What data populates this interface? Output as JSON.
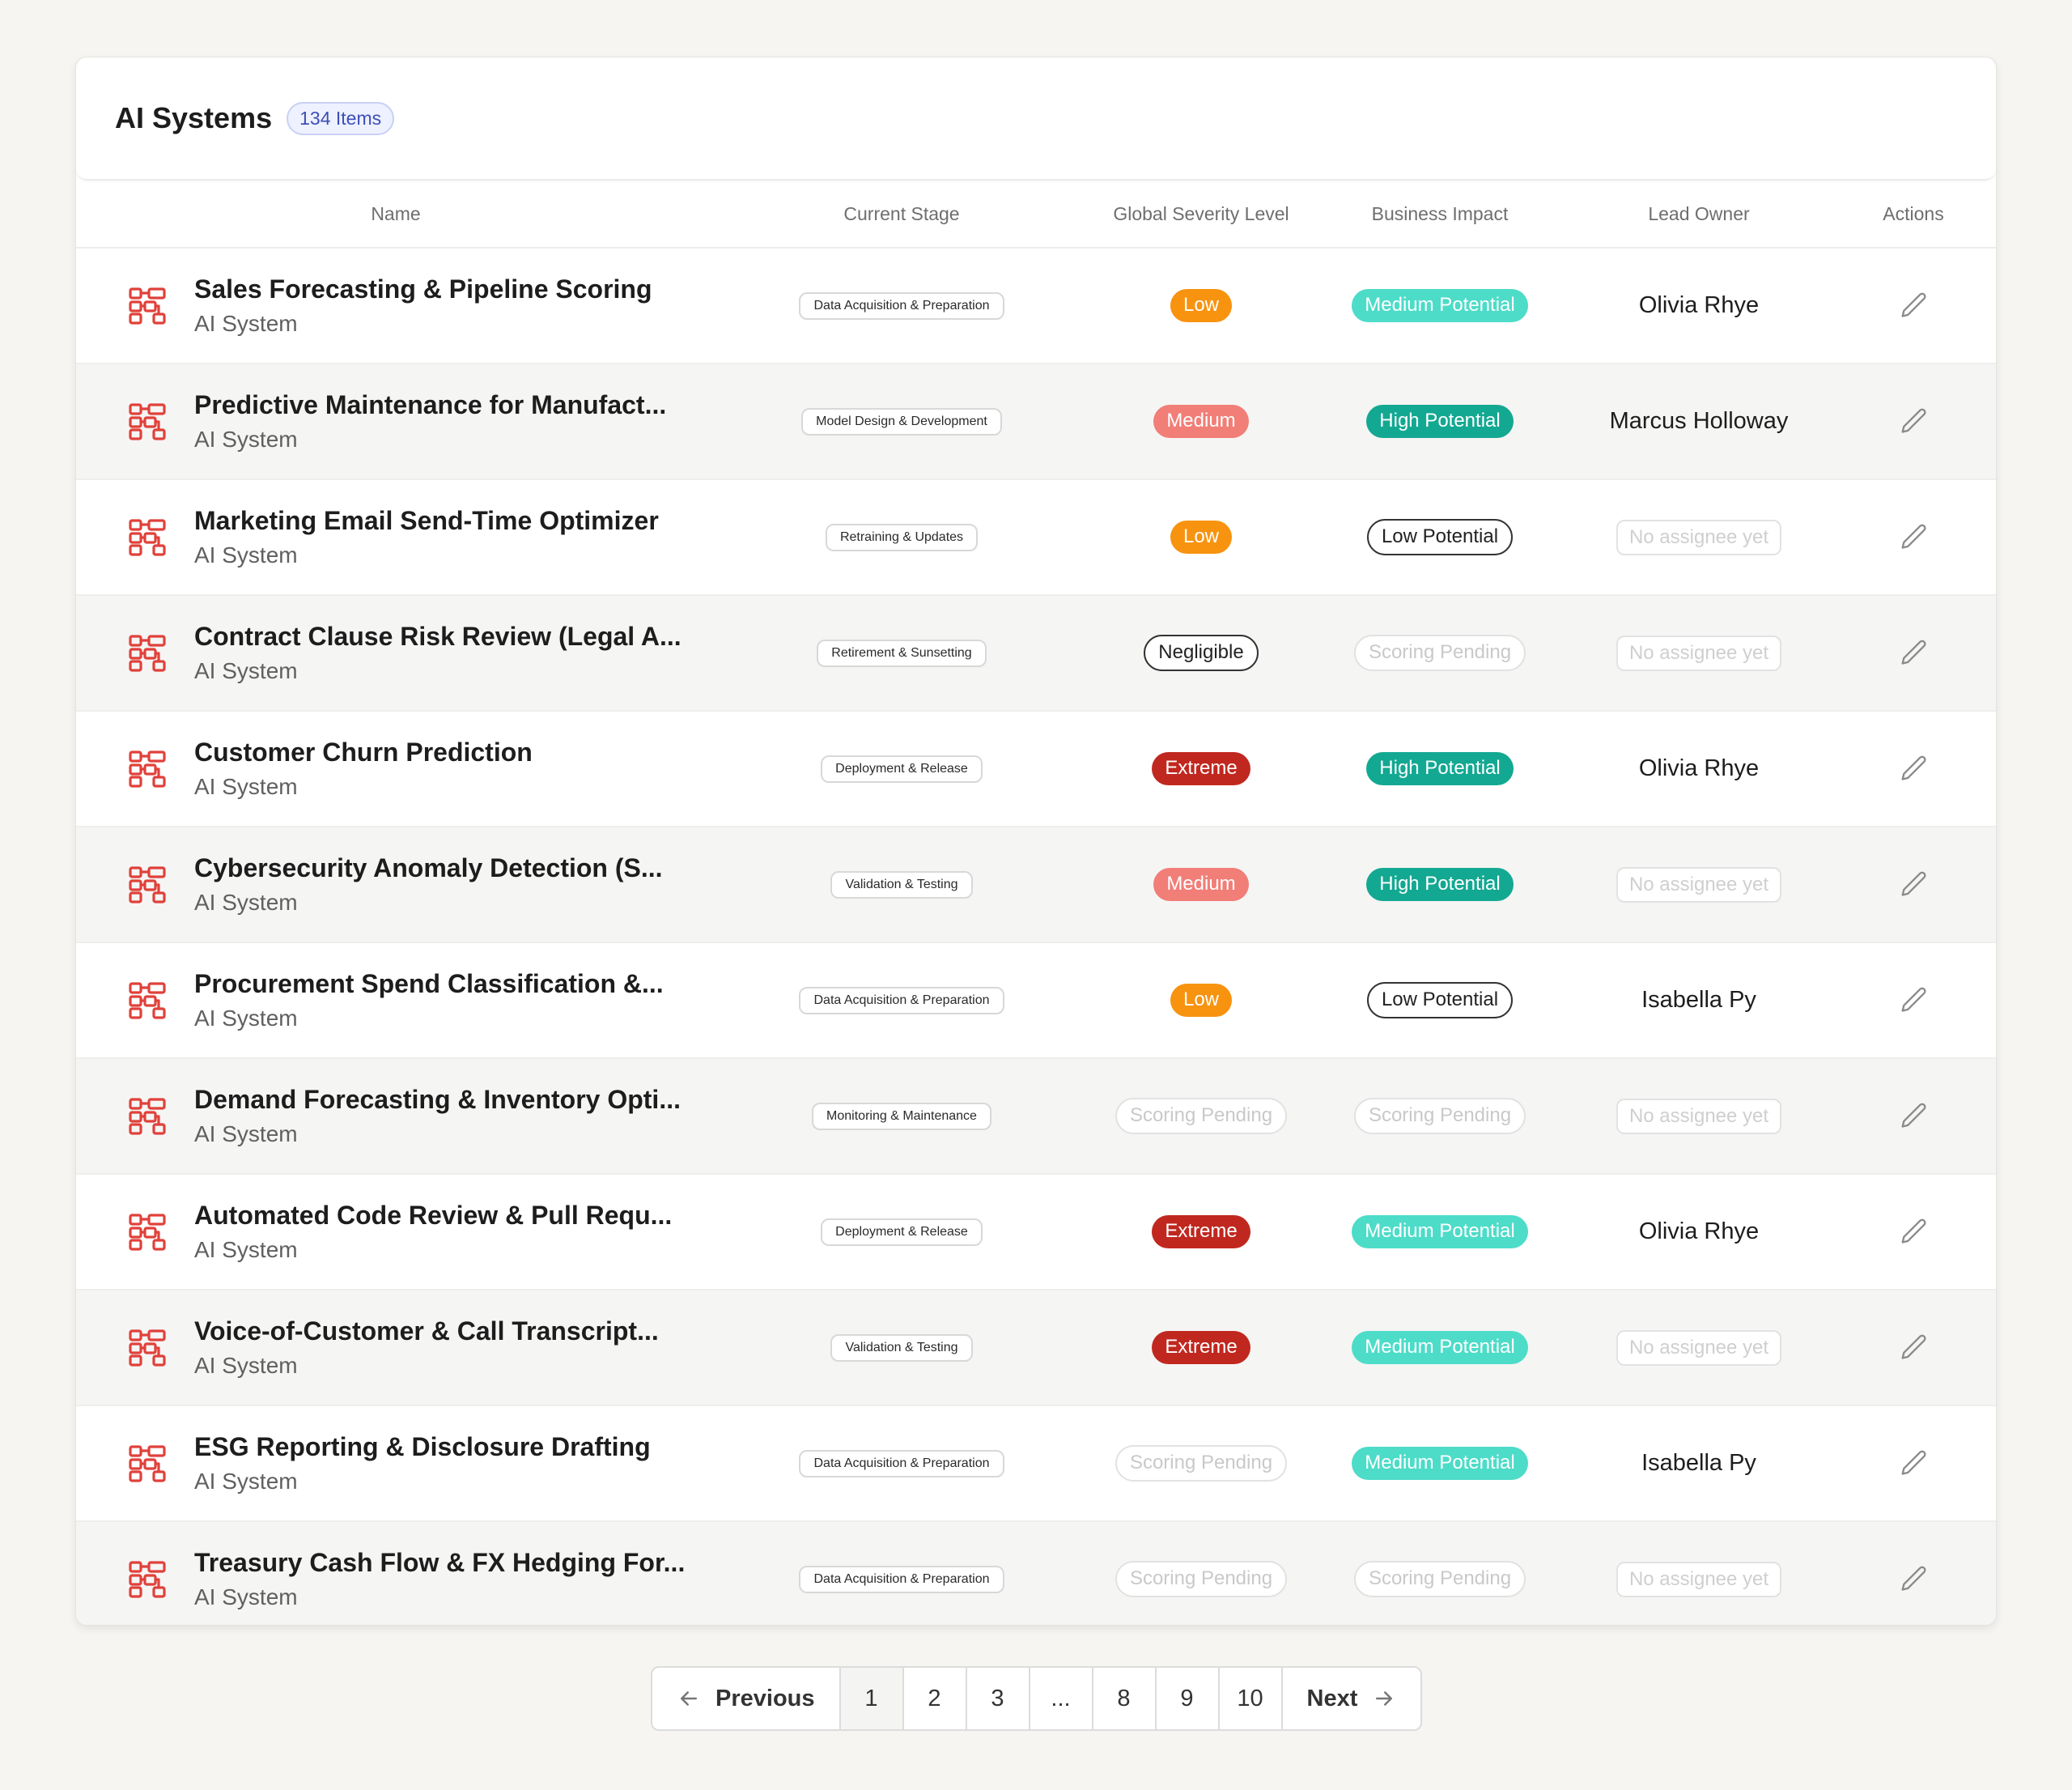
{
  "header": {
    "title": "AI Systems",
    "count": "134 Items"
  },
  "columns": {
    "name": "Name",
    "stage": "Current Stage",
    "severity": "Global Severity Level",
    "impact": "Business Impact",
    "owner": "Lead Owner",
    "actions": "Actions"
  },
  "rows": [
    {
      "name": "Sales Forecasting & Pipeline Scoring",
      "type": "AI System",
      "stage": "Data Acquisition & Preparation",
      "severity": "Low",
      "impact": "Medium Potential",
      "owner": "Olivia Rhye"
    },
    {
      "name": "Predictive Maintenance for Manufact...",
      "type": "AI System",
      "stage": "Model Design & Development",
      "severity": "Medium",
      "impact": "High  Potential",
      "owner": "Marcus Holloway"
    },
    {
      "name": "Marketing Email Send-Time Optimizer",
      "type": "AI System",
      "stage": "Retraining & Updates",
      "severity": "Low",
      "impact": "Low Potential",
      "owner": "No assignee yet"
    },
    {
      "name": "Contract Clause Risk Review (Legal A...",
      "type": "AI System",
      "stage": "Retirement & Sunsetting",
      "severity": "Negligible",
      "impact": "Scoring Pending",
      "owner": "No assignee yet"
    },
    {
      "name": "Customer Churn Prediction",
      "type": "AI System",
      "stage": "Deployment & Release",
      "severity": "Extreme",
      "impact": "High  Potential",
      "owner": "Olivia Rhye"
    },
    {
      "name": "Cybersecurity Anomaly Detection (S...",
      "type": "AI System",
      "stage": "Validation & Testing",
      "severity": "Medium",
      "impact": "High  Potential",
      "owner": "No assignee yet"
    },
    {
      "name": "Procurement Spend Classification &...",
      "type": "AI System",
      "stage": "Data Acquisition & Preparation",
      "severity": "Low",
      "impact": "Low Potential",
      "owner": "Isabella Py"
    },
    {
      "name": "Demand Forecasting & Inventory Opti...",
      "type": "AI System",
      "stage": "Monitoring & Maintenance",
      "severity": "Scoring Pending",
      "impact": "Scoring Pending",
      "owner": "No assignee yet"
    },
    {
      "name": "Automated Code Review & Pull Requ...",
      "type": "AI System",
      "stage": "Deployment & Release",
      "severity": "Extreme",
      "impact": "Medium Potential",
      "owner": "Olivia Rhye"
    },
    {
      "name": "Voice-of-Customer & Call Transcript...",
      "type": "AI System",
      "stage": "Validation & Testing",
      "severity": "Extreme",
      "impact": "Medium Potential",
      "owner": "No assignee yet"
    },
    {
      "name": "ESG Reporting & Disclosure Drafting",
      "type": "AI System",
      "stage": "Data Acquisition & Preparation",
      "severity": "Scoring Pending",
      "impact": "Medium Potential",
      "owner": "Isabella Py"
    },
    {
      "name": "Treasury Cash Flow & FX Hedging For...",
      "type": "AI System",
      "stage": "Data Acquisition & Preparation",
      "severity": "Scoring Pending",
      "impact": "Scoring Pending",
      "owner": "No assignee yet"
    }
  ],
  "pagination": {
    "previous": "Previous",
    "next": "Next",
    "pages": [
      "1",
      "2",
      "3",
      "...",
      "8",
      "9",
      "10"
    ],
    "current": "1"
  },
  "icons": {
    "row": "ai-system-icon",
    "action": "pencil-icon",
    "prev": "arrow-left-icon",
    "next": "arrow-right-icon"
  },
  "colors": {
    "icon": "#e0413a",
    "severity_low": "#f7930f",
    "severity_medium": "#f17e77",
    "severity_extreme": "#c0281f",
    "impact_medium": "#4ddcc8",
    "impact_high": "#13a892",
    "badge": "#3d4fb8"
  }
}
